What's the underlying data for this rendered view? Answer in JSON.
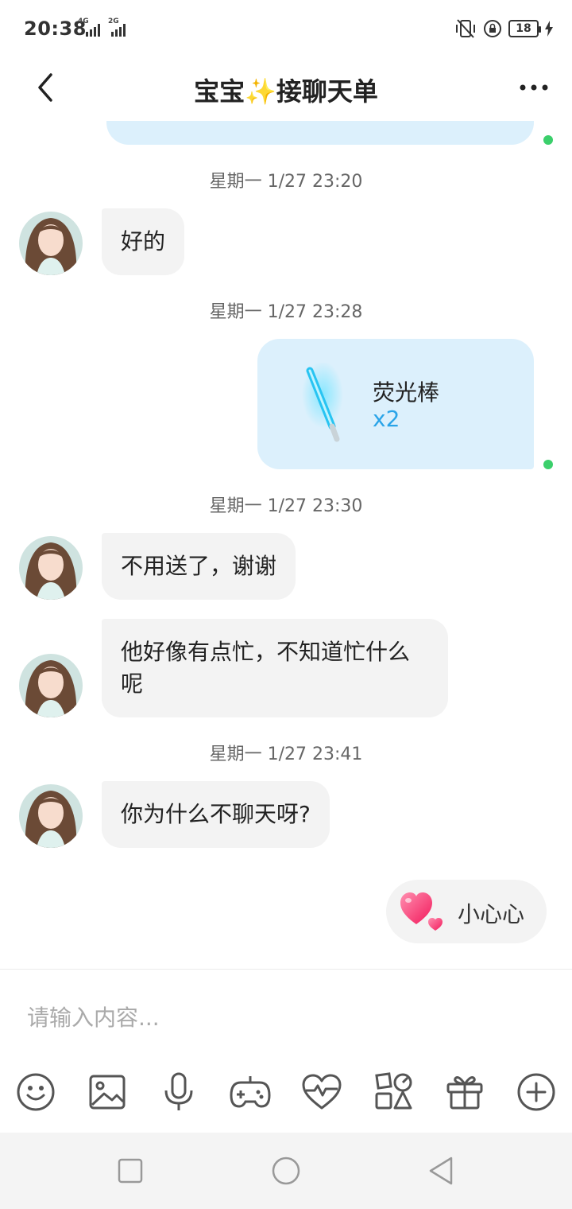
{
  "status_bar": {
    "time": "20:38",
    "signal1_label": "4G",
    "signal2_label": "2G",
    "battery": "18"
  },
  "header": {
    "title_prefix": "宝宝",
    "title_sparkle": "✨",
    "title_suffix": "接聊天单"
  },
  "messages": {
    "ts1": "星期一 1/27 23:20",
    "m1": "好的",
    "ts2": "星期一 1/27 23:28",
    "gift_name": "荧光棒",
    "gift_qty": "x2",
    "ts3": "星期一 1/27 23:30",
    "m2": "不用送了，谢谢",
    "m3": "他好像有点忙，不知道忙什么呢",
    "ts4": "星期一 1/27 23:41",
    "m4": "你为什么不聊天呀?"
  },
  "quick_reply": {
    "label": "小心心"
  },
  "input": {
    "placeholder": "请输入内容..."
  },
  "toolbar_icons": [
    "emoji-icon",
    "image-icon",
    "microphone-icon",
    "game-icon",
    "heartbeat-icon",
    "apps-icon",
    "gift-icon",
    "plus-icon"
  ],
  "colors": {
    "bubble_out": "#dcf0fc",
    "bubble_in": "#f3f3f3",
    "accent": "#2aa4e8",
    "sent_dot": "#3bcf6b"
  }
}
